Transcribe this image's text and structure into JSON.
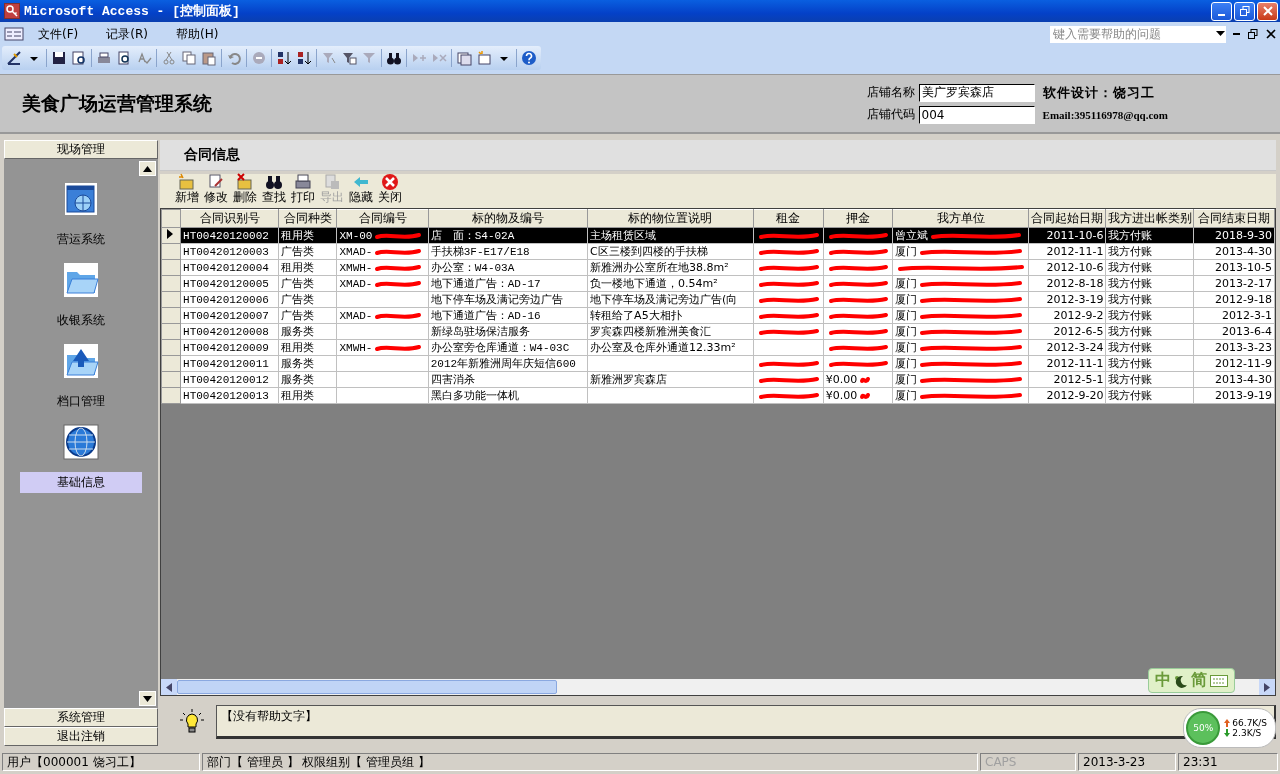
{
  "window": {
    "title": "Microsoft Access - [控制面板]"
  },
  "menu": [
    "文件(F)",
    "记录(R)",
    "帮助(H)"
  ],
  "help_search": {
    "placeholder": "键入需要帮助的问题"
  },
  "header": {
    "app_title": "美食广场运营管理系统",
    "store_name_label": "店铺名称",
    "store_name": "美广罗宾森店",
    "store_code_label": "店铺代码",
    "store_code": "004",
    "designer": "软件设计：饶习工",
    "email": "Email:395116978@qq.com"
  },
  "sidebar": {
    "group": "现场管理",
    "items": [
      {
        "label": "营运系统",
        "selected": false
      },
      {
        "label": "收银系统",
        "selected": false
      },
      {
        "label": "档口管理",
        "selected": false
      },
      {
        "label": "基础信息",
        "selected": true
      }
    ],
    "bottom_groups": [
      "系统管理",
      "退出注销"
    ]
  },
  "form": {
    "title": "合同信息",
    "actions": [
      {
        "label": "新增",
        "disabled": false
      },
      {
        "label": "修改",
        "disabled": false
      },
      {
        "label": "删除",
        "disabled": false
      },
      {
        "label": "查找",
        "disabled": false
      },
      {
        "label": "打印",
        "disabled": false
      },
      {
        "label": "导出",
        "disabled": true
      },
      {
        "label": "隐藏",
        "disabled": false
      },
      {
        "label": "关闭",
        "disabled": false
      }
    ]
  },
  "table": {
    "columns": [
      "合同识别号",
      "合同种类",
      "合同编号",
      "标的物及编号",
      "标的物位置说明",
      "租金",
      "押金",
      "我方单位",
      "合同起始日期",
      "我方进出帐类别",
      "合同结束日期"
    ],
    "rows": [
      {
        "selected": true,
        "cells": [
          "HT00420120002",
          "租用类",
          {
            "text": "XM-00",
            "redacted": true
          },
          "店　面：S4-02A",
          "主场租赁区域",
          {
            "redacted": true
          },
          {
            "redacted": true
          },
          {
            "text": "曾立斌",
            "redacted": true
          },
          "2011-10-6",
          "我方付账",
          "2018-9-30"
        ]
      },
      {
        "selected": false,
        "cells": [
          "HT00420120003",
          "广告类",
          {
            "text": "XMAD-",
            "redacted": true
          },
          "手扶梯3F-E17/E18",
          "C区三楼到四楼的手扶梯",
          {
            "redacted": true
          },
          {
            "redacted": true
          },
          {
            "text": "厦门",
            "redacted": true
          },
          "2012-11-1",
          "我方付账",
          "2013-4-30"
        ]
      },
      {
        "selected": false,
        "cells": [
          "HT00420120004",
          "租用类",
          {
            "text": "XMWH-",
            "redacted": true
          },
          "办公室：W4-03A",
          "新雅洲办公室所在地38.8m²",
          {
            "redacted": true
          },
          {
            "redacted": true
          },
          {
            "redacted": true
          },
          "2012-10-6",
          "我方付账",
          "2013-10-5"
        ]
      },
      {
        "selected": false,
        "cells": [
          "HT00420120005",
          "广告类",
          {
            "text": "XMAD-",
            "redacted": true
          },
          "地下通道广告：AD-17",
          "负一楼地下通道，0.54m²",
          {
            "redacted": true
          },
          {
            "redacted": true
          },
          {
            "text": "厦门",
            "redacted": true
          },
          "2012-8-18",
          "我方付账",
          "2013-2-17"
        ]
      },
      {
        "selected": false,
        "cells": [
          "HT00420120006",
          "广告类",
          null,
          "地下停车场及满记旁边广告",
          "地下停车场及满记旁边广告(向",
          {
            "redacted": true
          },
          {
            "redacted": true
          },
          {
            "text": "厦门",
            "redacted": true
          },
          "2012-3-19",
          "我方付账",
          "2012-9-18"
        ]
      },
      {
        "selected": false,
        "cells": [
          "HT00420120007",
          "广告类",
          {
            "text": "XMAD-",
            "redacted": true
          },
          "地下通道广告：AD-16",
          "转租给了A5大相扑",
          {
            "redacted": true
          },
          {
            "redacted": true
          },
          {
            "text": "厦门",
            "redacted": true
          },
          "2012-9-2",
          "我方付账",
          "2012-3-1"
        ]
      },
      {
        "selected": false,
        "cells": [
          "HT00420120008",
          "服务类",
          null,
          "新绿岛驻场保洁服务",
          "罗宾森四楼新雅洲美食汇",
          {
            "redacted": true
          },
          {
            "redacted": true
          },
          {
            "text": "厦门",
            "redacted": true
          },
          "2012-6-5",
          "我方付账",
          "2013-6-4"
        ]
      },
      {
        "selected": false,
        "cells": [
          "HT00420120009",
          "租用类",
          {
            "text": "XMWH-",
            "redacted": true
          },
          "办公室旁仓库通道：W4-03C",
          "办公室及仓库外通道12.33m²",
          null,
          {
            "redacted": true
          },
          {
            "text": "厦门",
            "redacted": true
          },
          "2012-3-24",
          "我方付账",
          "2013-3-23"
        ]
      },
      {
        "selected": false,
        "cells": [
          "HT00420120011",
          "服务类",
          null,
          "2012年新雅洲周年庆短信600",
          null,
          {
            "redacted": true
          },
          {
            "redacted": true
          },
          {
            "text": "厦门",
            "redacted": true
          },
          "2012-11-1",
          "我方付账",
          "2012-11-9"
        ]
      },
      {
        "selected": false,
        "cells": [
          "HT00420120012",
          "服务类",
          null,
          "四害消杀",
          "新雅洲罗宾森店",
          {
            "redacted": true
          },
          {
            "text": "¥0.00",
            "redacted": true
          },
          {
            "text": "厦门",
            "redacted": true
          },
          "2012-5-1",
          "我方付账",
          "2013-4-30"
        ]
      },
      {
        "selected": false,
        "cells": [
          "HT00420120013",
          "租用类",
          null,
          "黑白多功能一体机",
          null,
          {
            "redacted": true
          },
          {
            "text": "¥0.00",
            "redacted": true
          },
          {
            "text": "厦门",
            "redacted": true
          },
          "2012-9-20",
          "我方付账",
          "2013-9-19"
        ]
      }
    ]
  },
  "help_text": "【没有帮助文字】",
  "ime": {
    "mode": "中",
    "charset": "简"
  },
  "net_monitor": {
    "percent": "50%",
    "up": "66.7K/S",
    "down": "2.3K/S"
  },
  "status_bar": {
    "user": "用户【000001 饶习工】",
    "department": "部门【 管理员 】 权限组别【 管理员组 】",
    "caps": "CAPS",
    "date": "2013-3-23",
    "time": "23:31"
  }
}
